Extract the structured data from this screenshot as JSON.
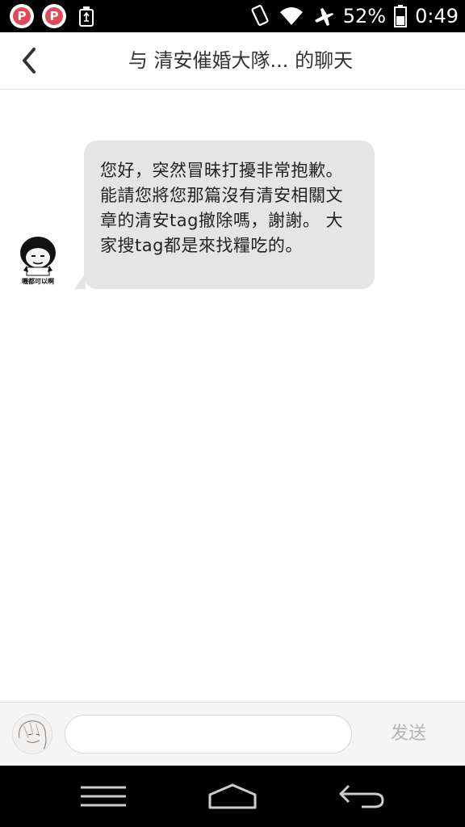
{
  "status_bar": {
    "battery_percent": "52%",
    "time": "0:49",
    "app_badge_letter": "P",
    "icons": [
      "p-app-icon",
      "p-app-icon",
      "recycle-icon",
      "vibrate-icon",
      "wifi-icon",
      "airplane-icon",
      "battery-icon"
    ]
  },
  "header": {
    "title": "与 清安催婚大隊... 的聊天",
    "back_icon": "chevron-left-icon"
  },
  "messages": [
    {
      "sender": "other",
      "avatar_caption": "嘰都可以啊",
      "text": "您好，突然冒昧打擾非常抱歉。能請您將您那篇沒有清安相關文章的清安tag撤除嗎，謝謝。 大家搜tag都是來找糧吃的。"
    }
  ],
  "input_bar": {
    "placeholder": "",
    "value": "",
    "send_label": "发送"
  },
  "nav_bar": {
    "icons": [
      "menu-icon",
      "home-icon",
      "back-icon"
    ]
  },
  "colors": {
    "status_bar_bg": "#000000",
    "bubble_bg": "#e5e5e5",
    "send_text": "#b3b3b3",
    "badge_red": "#e24a57"
  }
}
